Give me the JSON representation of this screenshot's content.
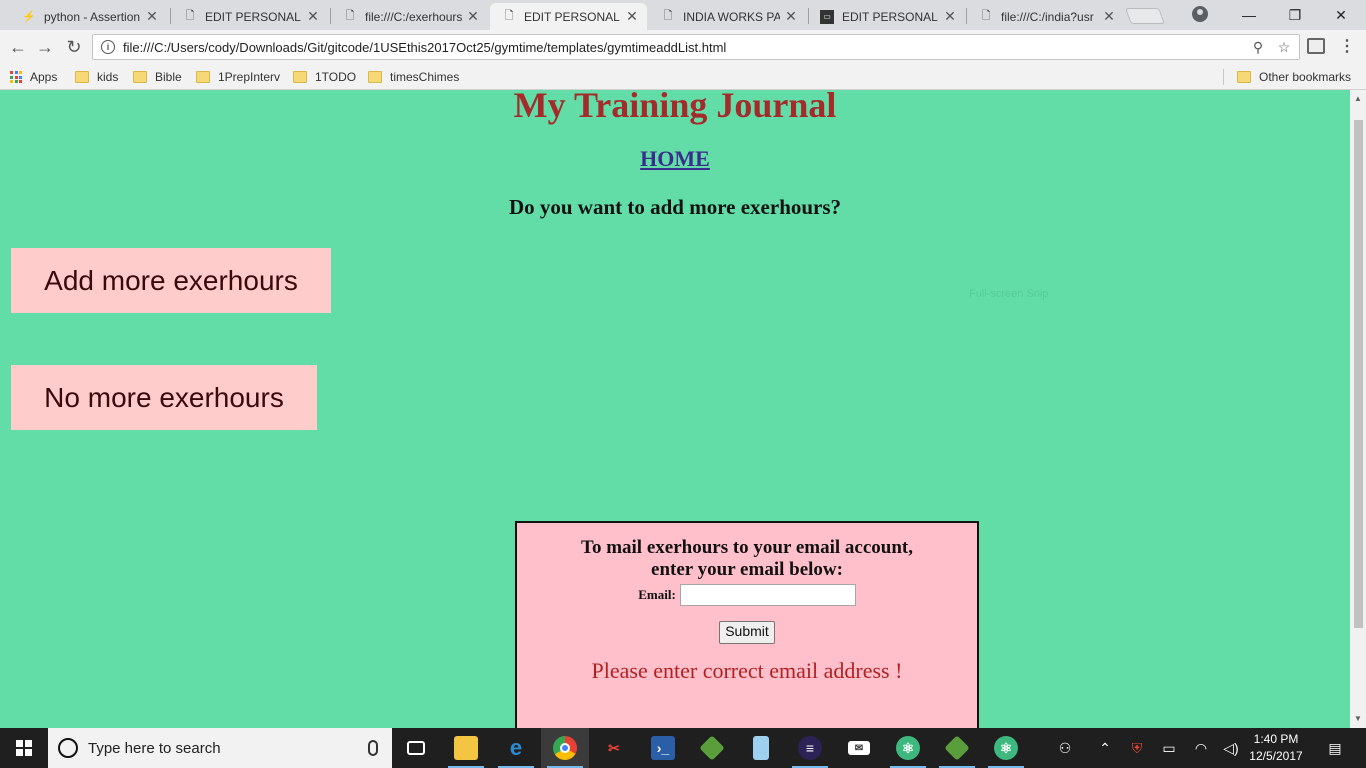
{
  "browser": {
    "tabs": [
      {
        "title": "python - Assertion",
        "icon": "stackoverflow-icon",
        "active": false
      },
      {
        "title": "EDIT PERSONAL T",
        "icon": "page-icon",
        "active": false
      },
      {
        "title": "file:///C:/exerhours",
        "icon": "page-icon",
        "active": false
      },
      {
        "title": "EDIT PERSONAL T",
        "icon": "page-icon",
        "active": true
      },
      {
        "title": "INDIA WORKS PAC",
        "icon": "page-icon",
        "active": false
      },
      {
        "title": "EDIT PERSONAL T",
        "icon": "terminal-icon",
        "active": false
      },
      {
        "title": "file:///C:/india?usr",
        "icon": "page-icon",
        "active": false
      }
    ],
    "url": "file:///C:/Users/cody/Downloads/Git/gitcode/1USEthis2017Oct25/gymtime/templates/gymtimeaddList.html",
    "bookmarks": [
      "Apps",
      "kids",
      "Bible",
      "1PrepInterv",
      "1TODO",
      "timesChimes"
    ],
    "other_bookmarks": "Other bookmarks"
  },
  "page": {
    "title": "My Training Journal",
    "home_link": "HOME",
    "question": "Do you want to add more exerhours?",
    "add_button": "Add more exerhours",
    "no_button": "No more exerhours",
    "faint_text": "Full-screen Snip",
    "mail": {
      "heading_line1": "To mail exerhours to your email account,",
      "heading_line2": "enter your email below:",
      "email_label": "Email:",
      "email_value": "",
      "submit_label": "Submit",
      "error": "Please enter correct email address !"
    },
    "colors": {
      "background": "#62dda8",
      "title": "#a52a2a",
      "button_bg": "#ffcccc",
      "mail_box_bg": "#ffc0cb",
      "error": "#b22222"
    }
  },
  "taskbar": {
    "search_placeholder": "Type here to search",
    "time": "1:40 PM",
    "date": "12/5/2017"
  }
}
